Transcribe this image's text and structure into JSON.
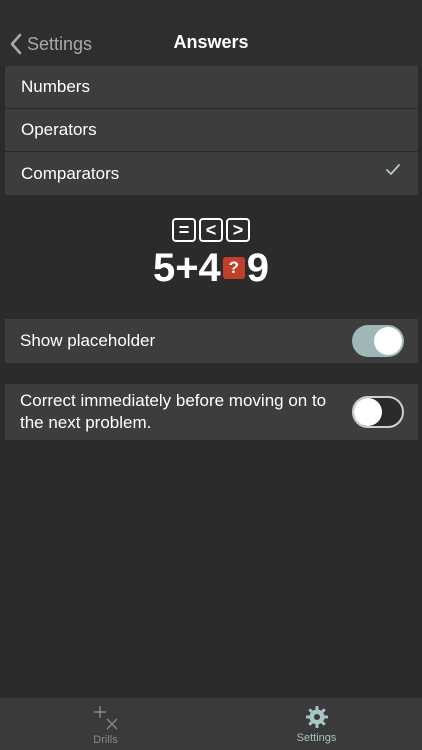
{
  "nav": {
    "back_label": "Settings",
    "title": "Answers"
  },
  "answer_types": {
    "items": [
      {
        "label": "Numbers",
        "selected": false
      },
      {
        "label": "Operators",
        "selected": false
      },
      {
        "label": "Comparators",
        "selected": true
      }
    ]
  },
  "preview": {
    "symbols": [
      "=",
      "<",
      ">"
    ],
    "expression": {
      "left": "5",
      "operator": "+",
      "right": "4",
      "placeholder": "?",
      "result": "9"
    }
  },
  "settings": {
    "show_placeholder": {
      "label": "Show placeholder",
      "on": true
    },
    "correct_immediately": {
      "label": "Correct immediately before moving on to the next problem.",
      "on": false
    }
  },
  "tabs": [
    {
      "label": "Drills",
      "icon": "plus-times-icon",
      "active": false
    },
    {
      "label": "Settings",
      "icon": "gear-icon",
      "active": true
    }
  ],
  "colors": {
    "background": "#2b2b2b",
    "cell": "#3d3d3d",
    "accent": "#9fb7b8",
    "placeholder": "#c1402a"
  }
}
